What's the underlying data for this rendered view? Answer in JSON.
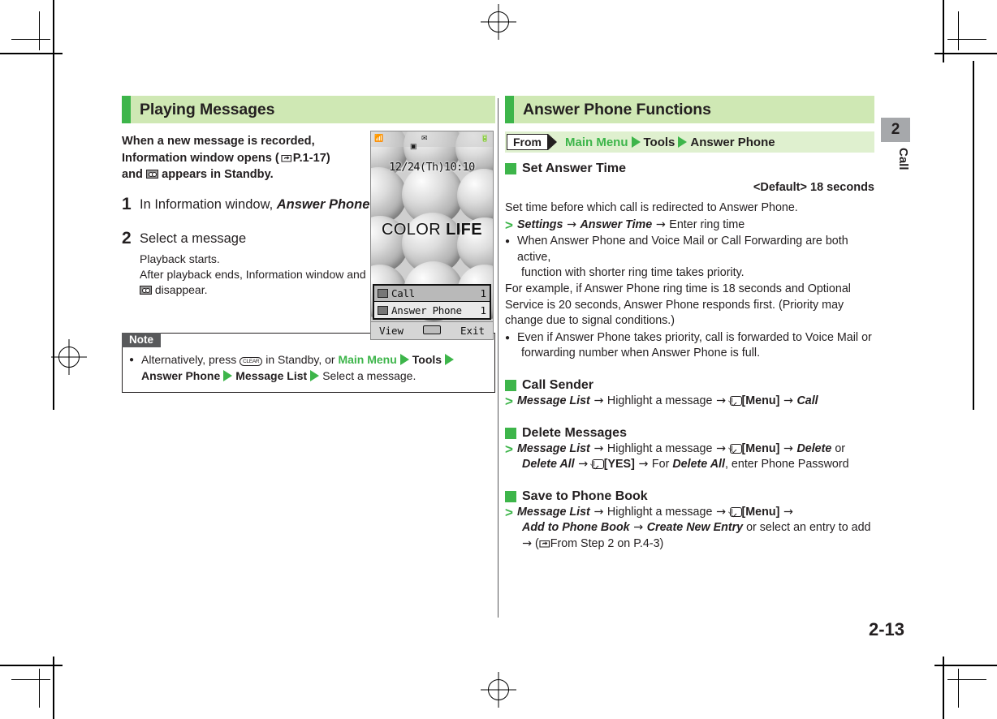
{
  "page": {
    "number": "2-13",
    "chapter_tab": "2",
    "chapter_label": "Call"
  },
  "left_column": {
    "section_title": "Playing Messages",
    "lead": {
      "line1": "When a new message is recorded,",
      "line2_a": "Information window opens (",
      "line2_ref": "P.1-17)",
      "line3_a": "and",
      "line3_b": "appears in Standby."
    },
    "steps": [
      {
        "num": "1",
        "head_plain": "In Information window, ",
        "head_em": "Answer Phone",
        "sub": []
      },
      {
        "num": "2",
        "head_plain": "Select a message",
        "head_em": "",
        "sub": [
          "Playback starts.",
          "After playback ends, Information window and",
          "disappear."
        ]
      }
    ],
    "note": {
      "tab_label": "Note",
      "item": {
        "a": "Alternatively, press",
        "key": "CLEAR",
        "b": "in Standby, or",
        "main_menu": "Main Menu",
        "tools": "Tools",
        "answer_phone": "Answer Phone",
        "message_list": "Message List",
        "tail": "Select a message."
      }
    },
    "screenshot": {
      "clock": "12/24(Th)10:10",
      "brand_light": "COLOR ",
      "brand_bold": "LIFE",
      "info_rows": [
        {
          "label": "Call",
          "count": "1"
        },
        {
          "label": "Answer Phone",
          "count": "1"
        }
      ],
      "softkeys": {
        "left": "View",
        "center": "center-key",
        "right": "Exit"
      }
    }
  },
  "right_column": {
    "section_title": "Answer Phone Functions",
    "from_bar": {
      "from_label": "From",
      "path_1": "Main Menu",
      "path_2": "Tools",
      "path_3": "Answer Phone"
    },
    "blocks": [
      {
        "heading": "Set Answer Time",
        "default_label": "<Default>",
        "default_value": "18 seconds",
        "lines": [
          {
            "type": "para",
            "text": "Set time before which call is redirected to Answer Phone."
          },
          {
            "type": "proc",
            "parts": [
              {
                "style": "em",
                "t": "Settings"
              },
              {
                "style": "arrow",
                "t": " → "
              },
              {
                "style": "em",
                "t": "Answer Time"
              },
              {
                "style": "arrow",
                "t": " → "
              },
              {
                "style": "plain",
                "t": "Enter ring time"
              }
            ]
          },
          {
            "type": "bullet",
            "text": "When Answer Phone and Voice Mail or Call Forwarding are both active,",
            "cont": "function with shorter ring time takes priority."
          },
          {
            "type": "para",
            "text": "For example, if Answer Phone ring time is 18 seconds and Optional Service is 20 seconds, Answer Phone responds first. (Priority may change due to signal conditions.)"
          },
          {
            "type": "bullet",
            "text": "Even if Answer Phone takes priority, call is forwarded to Voice Mail or",
            "cont": "forwarding number when Answer Phone is full."
          }
        ]
      },
      {
        "heading": "Call Sender",
        "proc_line1": [
          {
            "style": "em",
            "t": "Message List"
          },
          {
            "style": "arrow",
            "t": " → "
          },
          {
            "style": "plain",
            "t": "Highlight a message"
          },
          {
            "style": "arrow",
            "t": " → "
          },
          {
            "style": "envelope",
            "t": ""
          },
          {
            "style": "bold",
            "t": "[Menu]"
          },
          {
            "style": "arrow",
            "t": " → "
          },
          {
            "style": "em",
            "t": "Call"
          }
        ]
      },
      {
        "heading": "Delete Messages",
        "proc_line1": [
          {
            "style": "em",
            "t": "Message List"
          },
          {
            "style": "arrow",
            "t": " → "
          },
          {
            "style": "plain",
            "t": "Highlight a message"
          },
          {
            "style": "arrow",
            "t": " → "
          },
          {
            "style": "envelope",
            "t": ""
          },
          {
            "style": "bold",
            "t": "[Menu]"
          },
          {
            "style": "arrow",
            "t": " → "
          },
          {
            "style": "em",
            "t": "Delete"
          },
          {
            "style": "plain",
            "t": " or"
          }
        ],
        "proc_line2": [
          {
            "style": "em",
            "t": "Delete All"
          },
          {
            "style": "arrow",
            "t": " → "
          },
          {
            "style": "envelope",
            "t": ""
          },
          {
            "style": "bold",
            "t": "[YES]"
          },
          {
            "style": "arrow",
            "t": " → "
          },
          {
            "style": "plain",
            "t": "For "
          },
          {
            "style": "em",
            "t": "Delete All"
          },
          {
            "style": "plain",
            "t": ", enter Phone Password"
          }
        ]
      },
      {
        "heading": "Save to Phone Book",
        "proc_line1": [
          {
            "style": "em",
            "t": "Message List"
          },
          {
            "style": "arrow",
            "t": " → "
          },
          {
            "style": "plain",
            "t": "Highlight a message"
          },
          {
            "style": "arrow",
            "t": " → "
          },
          {
            "style": "envelope",
            "t": ""
          },
          {
            "style": "bold",
            "t": "[Menu]"
          },
          {
            "style": "arrow",
            "t": " →"
          }
        ],
        "proc_line2": [
          {
            "style": "em",
            "t": "Add to Phone Book"
          },
          {
            "style": "arrow",
            "t": " → "
          },
          {
            "style": "em",
            "t": "Create New Entry"
          },
          {
            "style": "plain",
            "t": " or select an entry to add"
          }
        ],
        "proc_line3_arrow": "→",
        "proc_line3_ref": "From Step 2 on P.4-3)"
      }
    ]
  },
  "colors": {
    "band_bg": "#cfe8b4",
    "band_bar": "#3db54a",
    "accent_green": "#3db54a",
    "from_bg": "#dff0cf",
    "note_border": "#231f20",
    "tab_gray": "#a6a8ab",
    "text": "#231f20"
  }
}
